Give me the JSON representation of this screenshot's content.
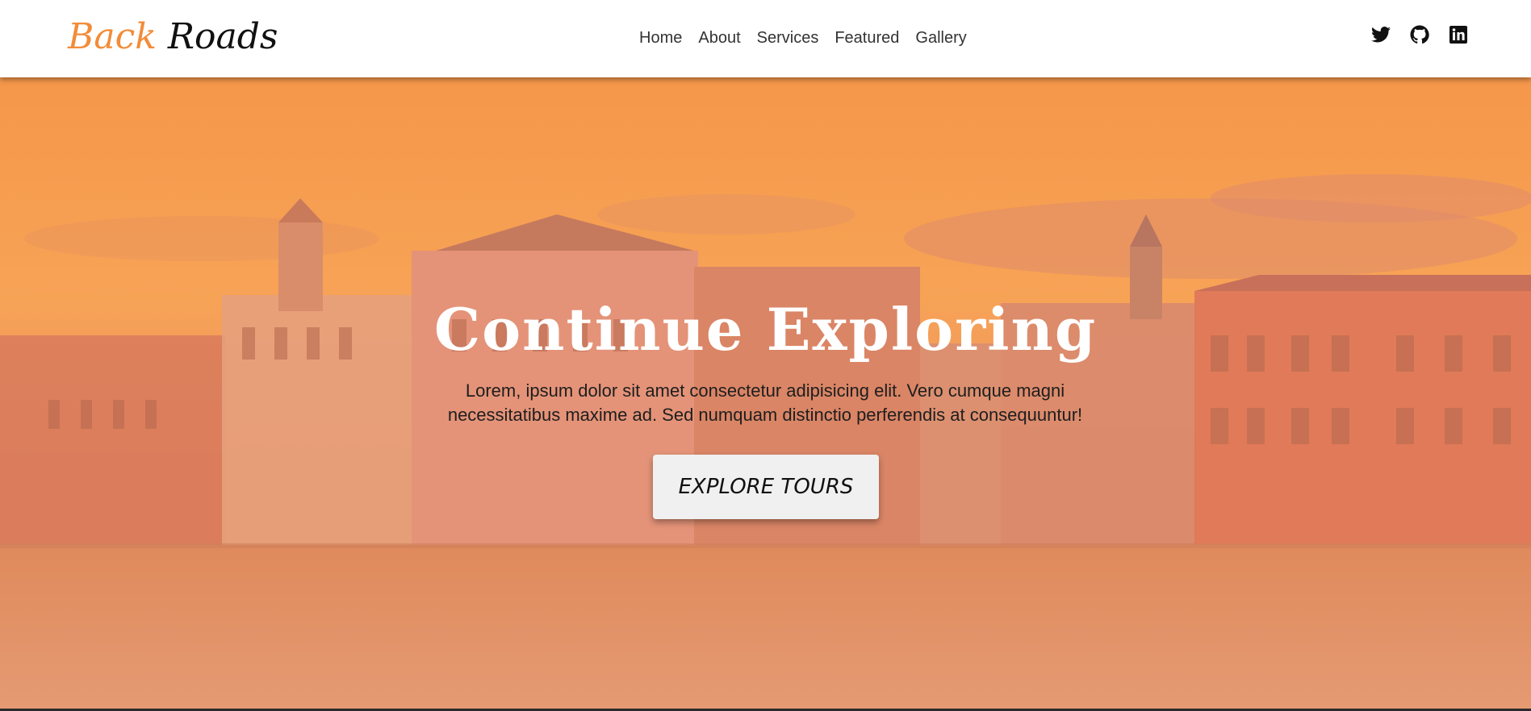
{
  "brand": {
    "name_part_1": "Back",
    "name_part_2": "Roads",
    "accent_color": "#f28c38"
  },
  "nav": {
    "links": [
      {
        "label": "Home"
      },
      {
        "label": "About"
      },
      {
        "label": "Services"
      },
      {
        "label": "Featured"
      },
      {
        "label": "Gallery"
      }
    ]
  },
  "socials": [
    {
      "icon": "twitter-icon"
    },
    {
      "icon": "github-icon"
    },
    {
      "icon": "linkedin-icon"
    }
  ],
  "hero": {
    "title": "Continue Exploring",
    "text_line_1": "Lorem, ipsum dolor sit amet consectetur adipisicing elit. Vero cumque magni",
    "text_line_2": "necessitatibus maxime ad. Sed numquam distinctio perferendis at consequuntur!",
    "button_label": "EXPLORE TOURS",
    "overlay_color": "#f59a4f"
  }
}
